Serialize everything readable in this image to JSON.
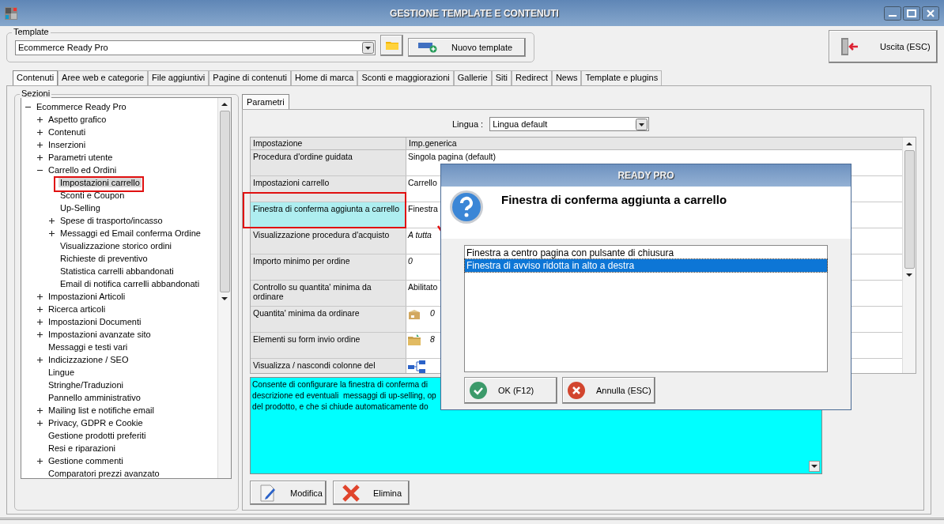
{
  "window": {
    "title": "GESTIONE TEMPLATE E CONTENUTI"
  },
  "template": {
    "legend": "Template",
    "value": "Ecommerce Ready Pro",
    "new_button": "Nuovo template"
  },
  "exit_button": "Uscita (ESC)",
  "tabs": [
    {
      "label": "Contenuti",
      "selected": true
    },
    {
      "label": "Aree web e categorie",
      "selected": false
    },
    {
      "label": "File aggiuntivi",
      "selected": false
    },
    {
      "label": "Pagine di contenuti",
      "selected": false
    },
    {
      "label": "Home di marca",
      "selected": false
    },
    {
      "label": "Sconti e maggiorazioni",
      "selected": false
    },
    {
      "label": "Gallerie",
      "selected": false
    },
    {
      "label": "Siti",
      "selected": false
    },
    {
      "label": "Redirect",
      "selected": false
    },
    {
      "label": "News",
      "selected": false
    },
    {
      "label": "Template e plugins",
      "selected": false
    }
  ],
  "sections": {
    "legend": "Sezioni",
    "items": [
      {
        "label": "Ecommerce Ready Pro",
        "expanded": true,
        "selected": false,
        "children": [
          {
            "label": "Aspetto grafico",
            "expanded": false,
            "selected": false
          },
          {
            "label": "Contenuti",
            "expanded": false,
            "selected": false
          },
          {
            "label": "Inserzioni",
            "expanded": false,
            "selected": false
          },
          {
            "label": "Parametri utente",
            "expanded": false,
            "selected": false
          },
          {
            "label": "Carrello ed Ordini",
            "expanded": true,
            "selected": false,
            "children": [
              {
                "label": "Impostazioni carrello",
                "selected": true
              },
              {
                "label": "Sconti e Coupon",
                "selected": false
              },
              {
                "label": "Up-Selling",
                "selected": false
              },
              {
                "label": "Spese di trasporto/incasso",
                "expanded": false,
                "selected": false
              },
              {
                "label": "Messaggi ed Email conferma Ordine",
                "expanded": false,
                "selected": false
              },
              {
                "label": "Visualizzazione storico ordini",
                "selected": false
              },
              {
                "label": "Richieste di preventivo",
                "selected": false
              },
              {
                "label": "Statistica carrelli abbandonati",
                "selected": false
              },
              {
                "label": "Email di notifica carrelli abbandonati",
                "selected": false
              }
            ]
          },
          {
            "label": "Impostazioni Articoli",
            "expanded": false,
            "selected": false
          },
          {
            "label": "Ricerca articoli",
            "expanded": false,
            "selected": false
          },
          {
            "label": "Impostazioni Documenti",
            "expanded": false,
            "selected": false
          },
          {
            "label": "Impostazioni avanzate sito",
            "expanded": false,
            "selected": false
          },
          {
            "label": "Messaggi e testi vari",
            "selected": false
          },
          {
            "label": "Indicizzazione / SEO",
            "expanded": false,
            "selected": false
          },
          {
            "label": "Lingue",
            "selected": false
          },
          {
            "label": "Stringhe/Traduzioni",
            "selected": false
          },
          {
            "label": "Pannello amministrativo",
            "selected": false
          },
          {
            "label": "Mailing list e notifiche email",
            "expanded": false,
            "selected": false
          },
          {
            "label": "Privacy, GDPR e Cookie",
            "expanded": false,
            "selected": false
          },
          {
            "label": "Gestione prodotti preferiti",
            "selected": false
          },
          {
            "label": "Resi e riparazioni",
            "selected": false
          },
          {
            "label": "Gestione commenti",
            "expanded": false,
            "selected": false
          },
          {
            "label": "Comparatori prezzi avanzato",
            "selected": false
          }
        ]
      }
    ]
  },
  "params_tab": {
    "label": "Parametri",
    "selected": true
  },
  "language": {
    "label": "Lingua :",
    "value": "Lingua default"
  },
  "table": {
    "columns": [
      "Impostazione",
      "Imp.generica"
    ],
    "rows": [
      {
        "label": "Procedura d'ordine guidata",
        "value": "Singola pagina (default)",
        "kind": "text",
        "selected": false
      },
      {
        "label": "Impostazioni carrello",
        "value": "Carrello",
        "kind": "text",
        "selected": false
      },
      {
        "label": "Finestra di conferma aggiunta a carrello",
        "value": "Finestra",
        "kind": "text",
        "selected": true
      },
      {
        "label": "Visualizzazione procedura d'acquisto",
        "value": "A tutta",
        "kind": "italic",
        "selected": false
      },
      {
        "label": "Importo minimo per ordine",
        "value": "0",
        "kind": "italic",
        "selected": false
      },
      {
        "label": "Controllo su quantita' minima da ordinare",
        "value": "Abilitato",
        "kind": "text",
        "selected": false
      },
      {
        "label": "Quantita' minima da ordinare",
        "value": "0",
        "kind": "box",
        "selected": false
      },
      {
        "label": "Elementi su form invio ordine",
        "value": "8",
        "kind": "folder",
        "selected": false
      },
      {
        "label": "Visualizza / nascondi colonne del",
        "kind": "diagram",
        "selected": false
      }
    ]
  },
  "description": {
    "lines": [
      "Consente di configurare la finestra di conferma di",
      "descrizione ed eventuali  messaggi di up-selling, op",
      "del prodotto, e che si chiude automaticamente do"
    ]
  },
  "buttons": [
    {
      "label": "Modifica",
      "kind": "edit"
    },
    {
      "label": "Elimina",
      "kind": "delete"
    }
  ],
  "dialog": {
    "title": "READY PRO",
    "heading": "Finestra di conferma aggiunta a carrello",
    "options": [
      {
        "label": "Finestra a centro pagina con pulsante di chiusura",
        "selected": false
      },
      {
        "label": "Finestra di avviso ridotta in alto a destra",
        "selected": true
      }
    ],
    "buttons": [
      {
        "label": "OK (F12)",
        "kind": "ok"
      },
      {
        "label": "Annulla (ESC)",
        "kind": "cancel"
      }
    ]
  }
}
